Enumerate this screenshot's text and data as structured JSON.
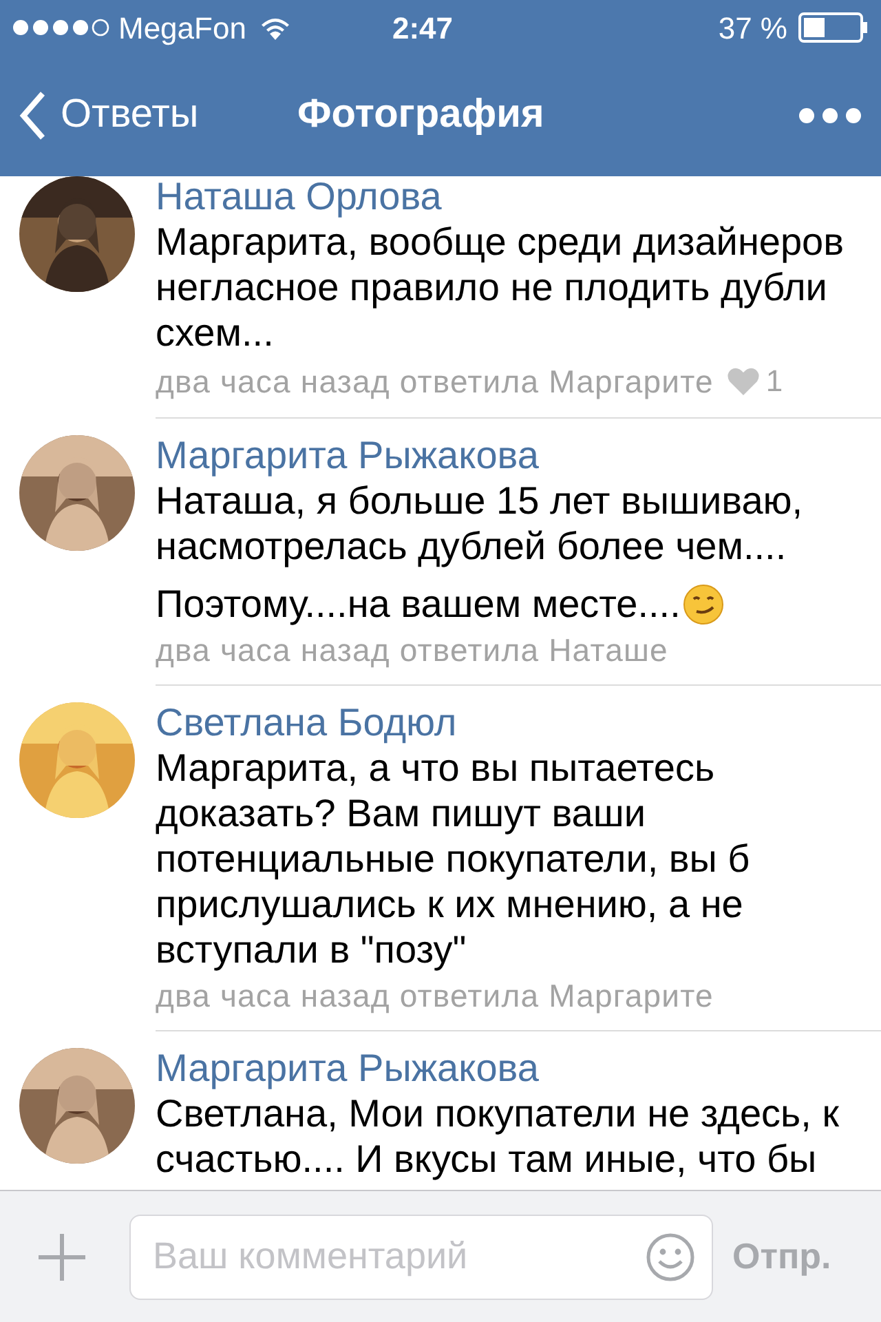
{
  "status_bar": {
    "carrier": "MegaFon",
    "time": "2:47",
    "battery": "37 %"
  },
  "nav_bar": {
    "back": "Ответы",
    "title": "Фотография"
  },
  "comments": [
    {
      "author": "Наташа Орлова",
      "paragraphs": [
        "Маргарита, вообще среди дизайнеров негласное правило не плодить дубли схем..."
      ],
      "meta": "два часа назад ответила Маргарите",
      "likes": "1",
      "emoji": false
    },
    {
      "author": "Маргарита Рыжакова",
      "paragraphs": [
        "Наташа, я больше 15 лет вышиваю, насмотрелась дублей более чем....",
        "Поэтому....на вашем месте...."
      ],
      "meta": "два часа назад ответила Наташе",
      "emoji": true
    },
    {
      "author": "Светлана Бодюл",
      "paragraphs": [
        "Маргарита, а что вы пытаетесь доказать? Вам пишут ваши потенциальные покупатели, вы б прислушались к их мнению, а не вступали в \"позу\""
      ],
      "meta": "два часа назад ответила Маргарите",
      "emoji": false
    },
    {
      "author": "Маргарита Рыжакова",
      "paragraphs": [
        "Светлана, Мои покупатели не здесь, к счастью.... И вкусы там иные, что бы"
      ],
      "emoji": false
    }
  ],
  "composer": {
    "placeholder": "Ваш комментарий",
    "send": "Отпр.",
    "send_disabled": true
  }
}
